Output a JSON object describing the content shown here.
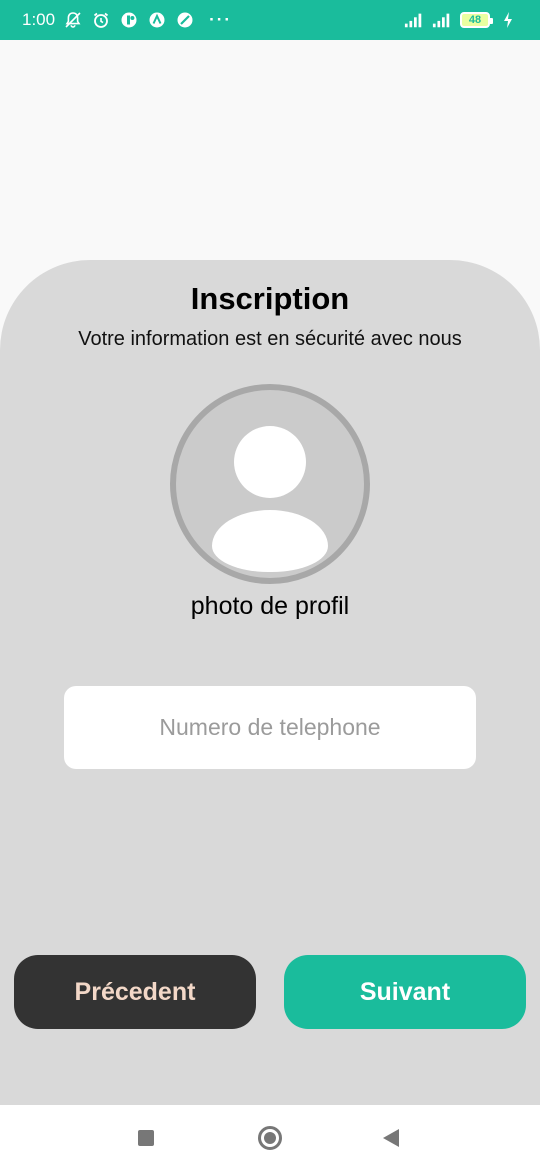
{
  "status_bar": {
    "time": "1:00",
    "battery_level": "48",
    "left_icons": [
      "muted-bell-icon",
      "alarm-icon",
      "app-icon",
      "app-icon-2",
      "app-icon-3"
    ],
    "more_indicator": "···",
    "right_icons": [
      "signal-icon",
      "signal-icon-2",
      "battery-icon",
      "charging-icon"
    ],
    "color": "#1abc9c"
  },
  "form": {
    "title": "Inscription",
    "subtitle": "Votre information est en sécurité avec nous",
    "photo_label": "photo de profil",
    "phone_placeholder": "Numero de telephone",
    "phone_value": ""
  },
  "buttons": {
    "previous_label": "Précedent",
    "next_label": "Suivant",
    "previous_color": "#333333",
    "next_color": "#1abc9c"
  },
  "nav_bar": {
    "icons": [
      "recent-apps-icon",
      "home-icon",
      "back-icon"
    ]
  }
}
